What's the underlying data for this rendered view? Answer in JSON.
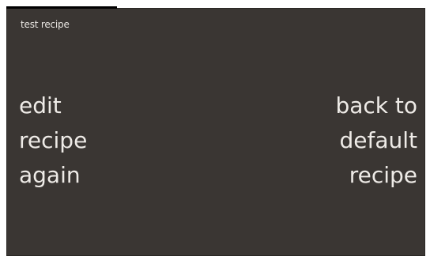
{
  "screen": {
    "title": "test recipe",
    "background_color": "#3a3633",
    "text_color": "#eeebe7"
  },
  "actions": {
    "left": {
      "lines": [
        "edit",
        "recipe",
        "again"
      ]
    },
    "right": {
      "lines": [
        "back to",
        "default",
        "recipe"
      ]
    }
  }
}
